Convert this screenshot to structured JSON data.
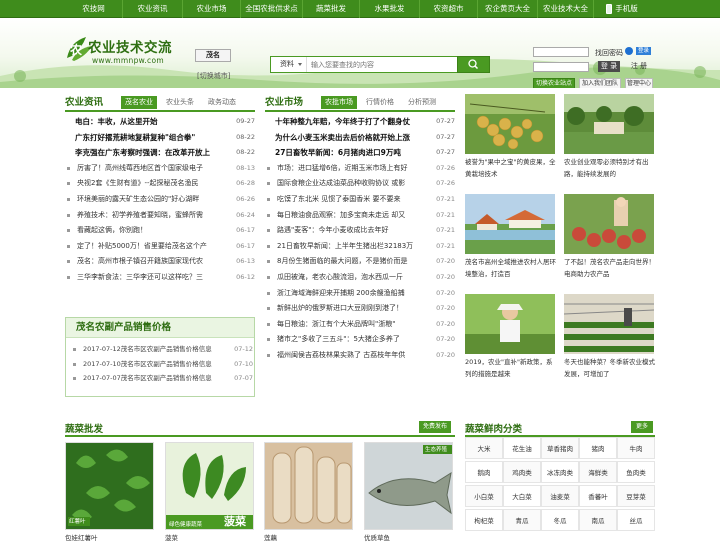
{
  "topnav": {
    "items": [
      "农技网",
      "农业资讯",
      "农业市场",
      "全国农批供求点",
      "蔬菜批发",
      "水果批发",
      "农资超市",
      "农企黄页大全",
      "农业技术大全",
      "手机版"
    ]
  },
  "header": {
    "logo_title": "农业技术交流",
    "logo_url": "www.mmnpw.com",
    "city": "茂名",
    "city_switch": "[切换城市]",
    "search_category": "资料",
    "search_placeholder": "输入您要查找的内容",
    "forgot_password": "找回密码",
    "qq_label": "登录",
    "login_label": "登 录",
    "register_label": "注 册",
    "btn_switch_site": "切换农业站点",
    "btn_add_fav": "加入我们团队",
    "btn_admin": "管理中心"
  },
  "news": {
    "title": "农业资讯",
    "tabs": [
      "茂名农业",
      "农业头条",
      "政务动态"
    ],
    "items": [
      {
        "t": "电白：丰收，从这里开始",
        "d": "09-27",
        "hot": true
      },
      {
        "t": "广东打好撂荒耕地复耕复种\"组合拳\"",
        "d": "08-22",
        "hot": true
      },
      {
        "t": "李克强在广东考察时强调：在改革开放上",
        "d": "08-22",
        "hot": true
      },
      {
        "t": "厉害了！高州线莓西地区首个国家级电子",
        "d": "08-13",
        "hot": false
      },
      {
        "t": "央视2套《生财有道》--起探秘茂名渔民",
        "d": "06-28",
        "hot": false
      },
      {
        "t": "环境美丽的露天矿生态公园的\"好心湖畔",
        "d": "06-26",
        "hot": false
      },
      {
        "t": "养殖技术：初学养殖者要知晓，蜜蜂所需",
        "d": "06-24",
        "hot": false
      },
      {
        "t": "看藏起这俩，你别跑！",
        "d": "06-17",
        "hot": false
      },
      {
        "t": "定了！补贴5000万！省里要给茂名这个产",
        "d": "06-17",
        "hot": false
      },
      {
        "t": "茂名：高州市根子镇召开籍族国家现代农",
        "d": "06-13",
        "hot": false
      },
      {
        "t": "三华李新食法：三华李还可以这样吃？三",
        "d": "06-12",
        "hot": false
      }
    ]
  },
  "price": {
    "title": "茂名农副产品销售价格",
    "items": [
      {
        "t": "2017-07-12茂名市区农副产品销售价格信息",
        "d": "07-12"
      },
      {
        "t": "2017-07-10茂名市区农副产品销售价格信息",
        "d": "07-10"
      },
      {
        "t": "2017-07-07茂名市区农副产品销售价格信息",
        "d": "07-07"
      }
    ]
  },
  "market": {
    "title": "农业市场",
    "tabs": [
      "农批市场",
      "行情价格",
      "分析预测"
    ],
    "items": [
      {
        "t": "十年种整九年赔，今年终于打了个翻身仗",
        "d": "07-27",
        "hot": true
      },
      {
        "t": "为什么小麦玉米卖出去后价格就开始上涨",
        "d": "07-27",
        "hot": true
      },
      {
        "t": "27日畜牧早新闻：6月猪肉进口9万吨",
        "d": "07-27",
        "hot": true
      },
      {
        "t": "市场：进口猛增6倍，近期玉米市场上有好",
        "d": "07-26",
        "hot": false
      },
      {
        "t": "国际食粮企业达成油菜品种收购协议 或影",
        "d": "07-26",
        "hot": false
      },
      {
        "t": "吃馍了东北米 见惯了泰国香米 要不要来",
        "d": "07-21",
        "hot": false
      },
      {
        "t": "每日粮油食品观察：加多宝商未走远 却又",
        "d": "07-21",
        "hot": false
      },
      {
        "t": "路遇\"麦客\"：今年小麦收成比去年好",
        "d": "07-21",
        "hot": false
      },
      {
        "t": "21日畜牧早新闻：上半年生猪出栏32183万",
        "d": "07-21",
        "hot": false
      },
      {
        "t": "8月份生猪面临的最大问题，不是猪价而是",
        "d": "07-20",
        "hot": false
      },
      {
        "t": "瓜田被淹，老农心酸流泪，泡水西瓜一斤",
        "d": "07-20",
        "hot": false
      },
      {
        "t": "浙江海域海鲜迎来开捕期 200余艘渔船捕",
        "d": "07-20",
        "hot": false
      },
      {
        "t": "新鲜出炉的俄罗斯进口大豆刚刚到港了！",
        "d": "07-20",
        "hot": false
      },
      {
        "t": "每日粮油：浙江有个大米品牌叫\"浙粮\"",
        "d": "07-20",
        "hot": false
      },
      {
        "t": "猪市之\"多收了三五斗\"：5大猪企多养了",
        "d": "07-20",
        "hot": false
      },
      {
        "t": "福州闽侯吉荔枝林果实熟了 古荔枝年年供",
        "d": "07-20",
        "hot": false
      }
    ]
  },
  "gallery": [
    {
      "cap": "被誉为\"果中之宝\"的黄皮果，全黄栽培技术"
    },
    {
      "cap": "农业创业观零必须特别才有出路，能持续发展的"
    },
    {
      "cap": "茂名市高州全域推进农村人居环境整治，打造百"
    },
    {
      "cap": "了不起！茂名农产品走向世界！电商助力农产品"
    },
    {
      "cap": "2019，农业\"直补\"新政策，系列的措施是越来"
    },
    {
      "cap": "冬天也能种菜？冬季新农业模式发展，可增加了"
    }
  ],
  "veg": {
    "title": "蔬菜批发",
    "more": "免费发布",
    "items": [
      {
        "cap": "包娃红薯叶"
      },
      {
        "cap": "菠菜"
      },
      {
        "cap": "莲藕"
      },
      {
        "cap": "优质草鱼"
      }
    ],
    "img_badge_1": "红薯叶",
    "img_badge_2": "绿色健康蔬菜",
    "img_badge_2b": "菠菜",
    "img_badge_4": "生态养殖"
  },
  "category": {
    "title": "蔬菜鲜肉分类",
    "more": "更多",
    "rows": [
      [
        "大米",
        "花生油",
        "草香猪肉",
        "猪肉",
        "牛肉"
      ],
      [
        "鹅肉",
        "鸡肉类",
        "冰冻肉类",
        "海鲜类",
        "鱼肉类"
      ],
      [
        "小白菜",
        "大白菜",
        "油麦菜",
        "香蕃叶",
        "豆芽菜"
      ],
      [
        "枸杞菜",
        "青瓜",
        "冬瓜",
        "南瓜",
        "丝瓜"
      ]
    ]
  },
  "colors": {
    "brand_green": "#3f8c1c",
    "accent": "#4a9a22",
    "title_green": "#2f6e12"
  }
}
